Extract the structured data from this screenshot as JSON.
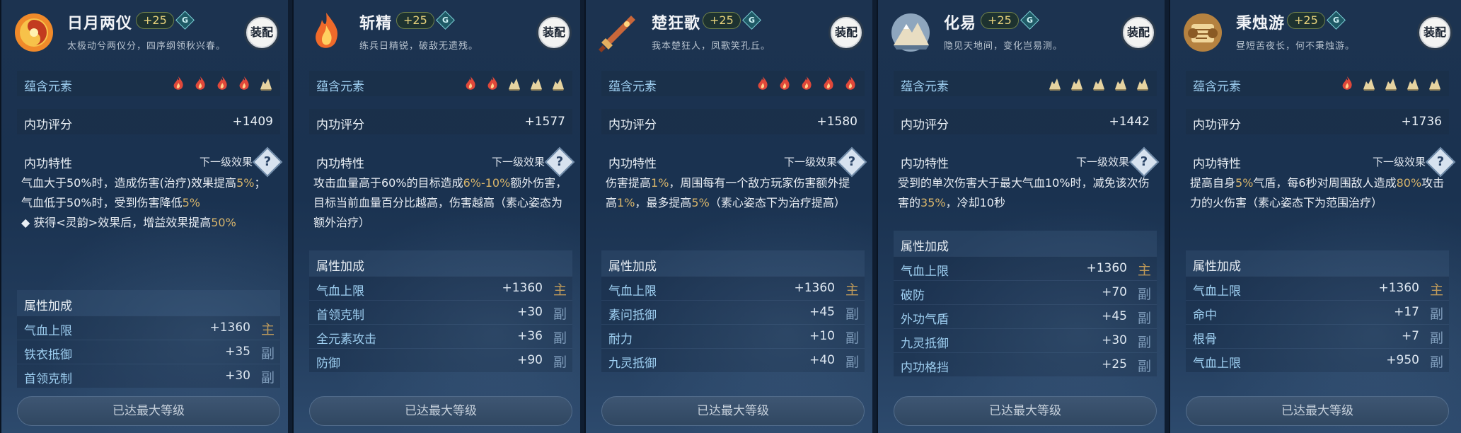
{
  "ui": {
    "equip_label": "装配",
    "elements_label": "蕴含元素",
    "score_label": "内功评分",
    "trait_label": "内功特性",
    "next_effect_label": "下一级效果",
    "help_glyph": "?",
    "gem_glyph": "G",
    "attr_label": "属性加成",
    "max_level_label": "已达最大等级"
  },
  "cards": [
    {
      "title": "日月两仪",
      "level": "+25",
      "desc": "太极动兮两仪分，四序纲领秋兴春。",
      "icon": "sun-moon-icon",
      "elements": [
        "fire",
        "fire",
        "fire",
        "fire",
        "earth"
      ],
      "score": "+1409",
      "trait": {
        "text_a": "气血大于50%时，造成伤害(治疗)效果提高",
        "hl1": "5%",
        "text_b": "；气血低于50%时，受到伤害降低",
        "hl2": "5%",
        "bullet": "◆ 获得<灵韵>效果后，增益效果提高",
        "hl3": "50%"
      },
      "attrs": [
        {
          "name": "气血上限",
          "value": "+1360",
          "tag": "主"
        },
        {
          "name": "铁衣抵御",
          "value": "+35",
          "tag": "副"
        },
        {
          "name": "首领克制",
          "value": "+30",
          "tag": "副"
        }
      ]
    },
    {
      "title": "斩精",
      "level": "+25",
      "desc": "练兵日精锐，破敌无遗残。",
      "icon": "flame-icon",
      "elements": [
        "fire",
        "fire",
        "earth",
        "earth",
        "earth"
      ],
      "score": "+1577",
      "trait": {
        "text_a": "攻击血量高于60%的目标造成",
        "hl1": "6%-10%",
        "text_b": "额外伤害，目标当前血量百分比越高，伤害越高（素心姿态为额外治疗）",
        "hl2": "",
        "bullet": "",
        "hl3": ""
      },
      "attrs": [
        {
          "name": "气血上限",
          "value": "+1360",
          "tag": "主"
        },
        {
          "name": "首领克制",
          "value": "+30",
          "tag": "副"
        },
        {
          "name": "全元素攻击",
          "value": "+36",
          "tag": "副"
        },
        {
          "name": "防御",
          "value": "+90",
          "tag": "副"
        }
      ]
    },
    {
      "title": "楚狂歌",
      "level": "+25",
      "desc": "我本楚狂人，凤歌笑孔丘。",
      "icon": "sword-icon",
      "elements": [
        "fire",
        "fire",
        "fire",
        "fire",
        "fire"
      ],
      "score": "+1580",
      "trait": {
        "text_a": "伤害提高",
        "hl1": "1%",
        "text_b": "，周围每有一个敌方玩家伤害额外提高",
        "hl2": "1%",
        "text_c": "，最多提高",
        "hl3": "5%",
        "text_d": "（素心姿态下为治疗提高）"
      },
      "attrs": [
        {
          "name": "气血上限",
          "value": "+1360",
          "tag": "主"
        },
        {
          "name": "素问抵御",
          "value": "+45",
          "tag": "副"
        },
        {
          "name": "耐力",
          "value": "+10",
          "tag": "副"
        },
        {
          "name": "九灵抵御",
          "value": "+40",
          "tag": "副"
        }
      ]
    },
    {
      "title": "化易",
      "level": "+25",
      "desc": "隐见天地间，变化岂易测。",
      "icon": "mountain-icon",
      "elements": [
        "earth",
        "earth",
        "earth",
        "earth",
        "earth"
      ],
      "score": "+1442",
      "trait": {
        "text_a": "受到的单次伤害大于最大气血10%时，减免该次伤害的",
        "hl1": "35%",
        "text_b": "，冷却10秒",
        "hl2": "",
        "bullet": "",
        "hl3": ""
      },
      "attrs": [
        {
          "name": "气血上限",
          "value": "+1360",
          "tag": "主"
        },
        {
          "name": "破防",
          "value": "+70",
          "tag": "副"
        },
        {
          "name": "外功气盾",
          "value": "+45",
          "tag": "副"
        },
        {
          "name": "九灵抵御",
          "value": "+30",
          "tag": "副"
        },
        {
          "name": "内功格挡",
          "value": "+25",
          "tag": "副"
        }
      ]
    },
    {
      "title": "秉烛游",
      "level": "+25",
      "desc": "昼短苦夜长，何不秉烛游。",
      "icon": "scroll-icon",
      "elements": [
        "fire",
        "earth",
        "earth",
        "earth",
        "earth"
      ],
      "score": "+1736",
      "trait": {
        "text_a": "提高自身",
        "hl1": "5%",
        "text_b": "气盾，每6秒对周围敌人造成",
        "hl2": "80%",
        "text_c": "攻击力的火伤害（素心姿态下为范围治疗）",
        "hl3": "",
        "text_d": ""
      },
      "attrs": [
        {
          "name": "气血上限",
          "value": "+1360",
          "tag": "主"
        },
        {
          "name": "命中",
          "value": "+17",
          "tag": "副"
        },
        {
          "name": "根骨",
          "value": "+7",
          "tag": "副"
        },
        {
          "name": "气血上限",
          "value": "+950",
          "tag": "副"
        }
      ]
    }
  ],
  "colors": {
    "fire": "#e0483a",
    "earth": "#e6d3a0",
    "gold_highlight": "#d7b46a",
    "attr_blue": "#9fd0f2"
  }
}
